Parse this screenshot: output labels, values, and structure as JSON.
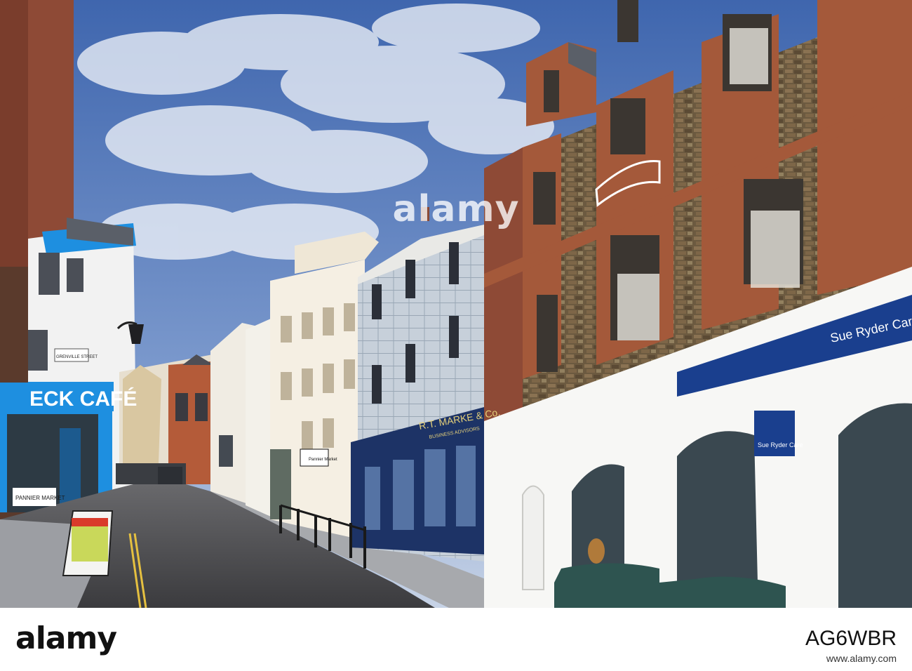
{
  "watermark": {
    "logo_text": "alamy",
    "image_id": "AG6WBR",
    "url": "www.alamy.com"
  },
  "signs": {
    "cafe": "ECK CAFÉ",
    "street": "GRENVILLE STREET",
    "pannier_market": "PANNIER MARKET",
    "market_arrow": "Pannier Market",
    "shop_marke": "R.T. MARKE & Co.",
    "shop_marke_sub": "BUSINESS ADVISORS",
    "charity_fascia": "Sue Ryder Care",
    "charity_hanging": "Sue Ryder Care"
  },
  "colors": {
    "sky": "#4a72b6",
    "cafe_blue": "#1e8fe0",
    "charity_blue": "#1a3f8e",
    "sandstone": "#a4593a",
    "navy_shop": "#1d3366"
  }
}
